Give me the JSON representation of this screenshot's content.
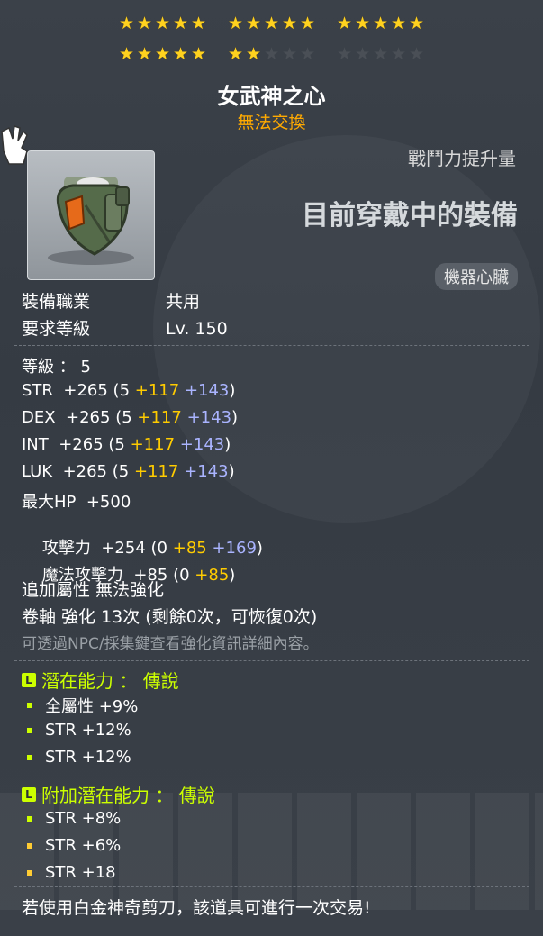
{
  "stars": {
    "row1": [
      5,
      5,
      5
    ],
    "row2_filled": 7,
    "row2_total": 15
  },
  "item": {
    "name": "女武神之心",
    "trade_status": "無法交換",
    "power_label": "戰鬥力提升量",
    "power_value": "目前穿戴中的裝備",
    "category": "機器心臟",
    "job_label": "裝備職業",
    "job_value": "共用",
    "level_req_label": "要求等級",
    "level_req_value": "Lv. 150",
    "icon": "mechanical-heart-icon"
  },
  "stats": {
    "level": "等級 ： 5",
    "lines": [
      {
        "name": "STR",
        "total": "+265",
        "base": "(5 ",
        "bonus": "+117",
        "enhance": "+143",
        "close": ")"
      },
      {
        "name": "DEX",
        "total": "+265",
        "base": "(5 ",
        "bonus": "+117",
        "enhance": "+143",
        "close": ")"
      },
      {
        "name": "INT",
        "total": "+265",
        "base": "(5 ",
        "bonus": "+117",
        "enhance": "+143",
        "close": ")"
      },
      {
        "name": "LUK",
        "total": "+265",
        "base": "(5 ",
        "bonus": "+117",
        "enhance": "+143",
        "close": ")"
      }
    ],
    "hp": "最大HP  +500",
    "attack": {
      "name": "攻擊力",
      "total": "+254",
      "base": "(0 ",
      "bonus": "+85",
      "enhance": "+169",
      "close": ")"
    },
    "magic": {
      "name": "魔法攻擊力",
      "total": "+85",
      "base": "(0 ",
      "bonus": "+85",
      "close": ")"
    },
    "extra_attr": "追加屬性 無法強化",
    "scroll": "卷軸 強化 13次 (剩餘0次，可恢復0次)",
    "hint": "可透過NPC/採集鍵查看強化資訊詳細內容。"
  },
  "potential": {
    "title": "潛在能力 ： 傳說",
    "grade_letter": "L",
    "lines": [
      "全屬性 +9%",
      "STR +12%",
      "STR +12%"
    ]
  },
  "bonus_potential": {
    "title": "附加潛在能力 ： 傳說",
    "grade_letter": "L",
    "lines": [
      "STR +8%",
      "STR +6%",
      "STR +18"
    ]
  },
  "footer": "若使用白金神奇剪刀，該道具可進行一次交易!",
  "colors": {
    "star_on": "#ffd21f",
    "star_off": "#4a4f56",
    "untradeable": "#ffaa00",
    "bonus_stat": "#ffcc00",
    "enhance_stat": "#aab4ff",
    "legendary": "#ccff00"
  }
}
